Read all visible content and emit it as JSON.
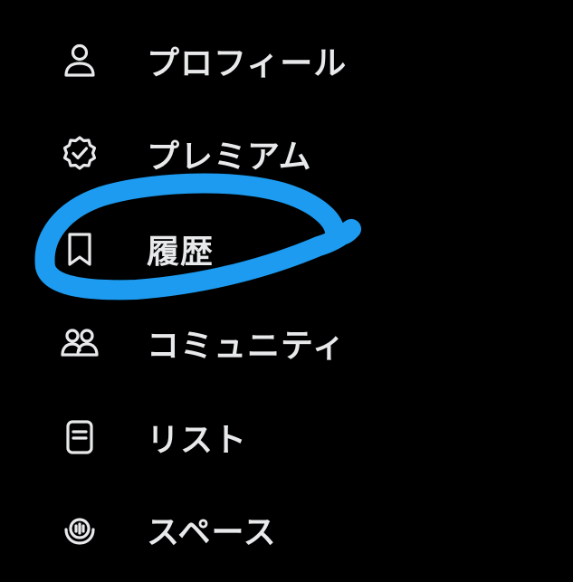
{
  "menu": {
    "items": [
      {
        "label": "プロフィール",
        "icon": "person-icon"
      },
      {
        "label": "プレミアム",
        "icon": "verified-badge-icon"
      },
      {
        "label": "履歴",
        "icon": "bookmark-icon"
      },
      {
        "label": "コミュニティ",
        "icon": "people-icon"
      },
      {
        "label": "リスト",
        "icon": "list-document-icon"
      },
      {
        "label": "スペース",
        "icon": "spaces-microphone-icon"
      }
    ]
  },
  "annotation": {
    "shape": "hand-drawn-circle",
    "color": "#1d9bf0",
    "target": "履歴"
  },
  "colors": {
    "background": "#000000",
    "text": "#e7e9ea",
    "highlight": "#1d9bf0"
  }
}
